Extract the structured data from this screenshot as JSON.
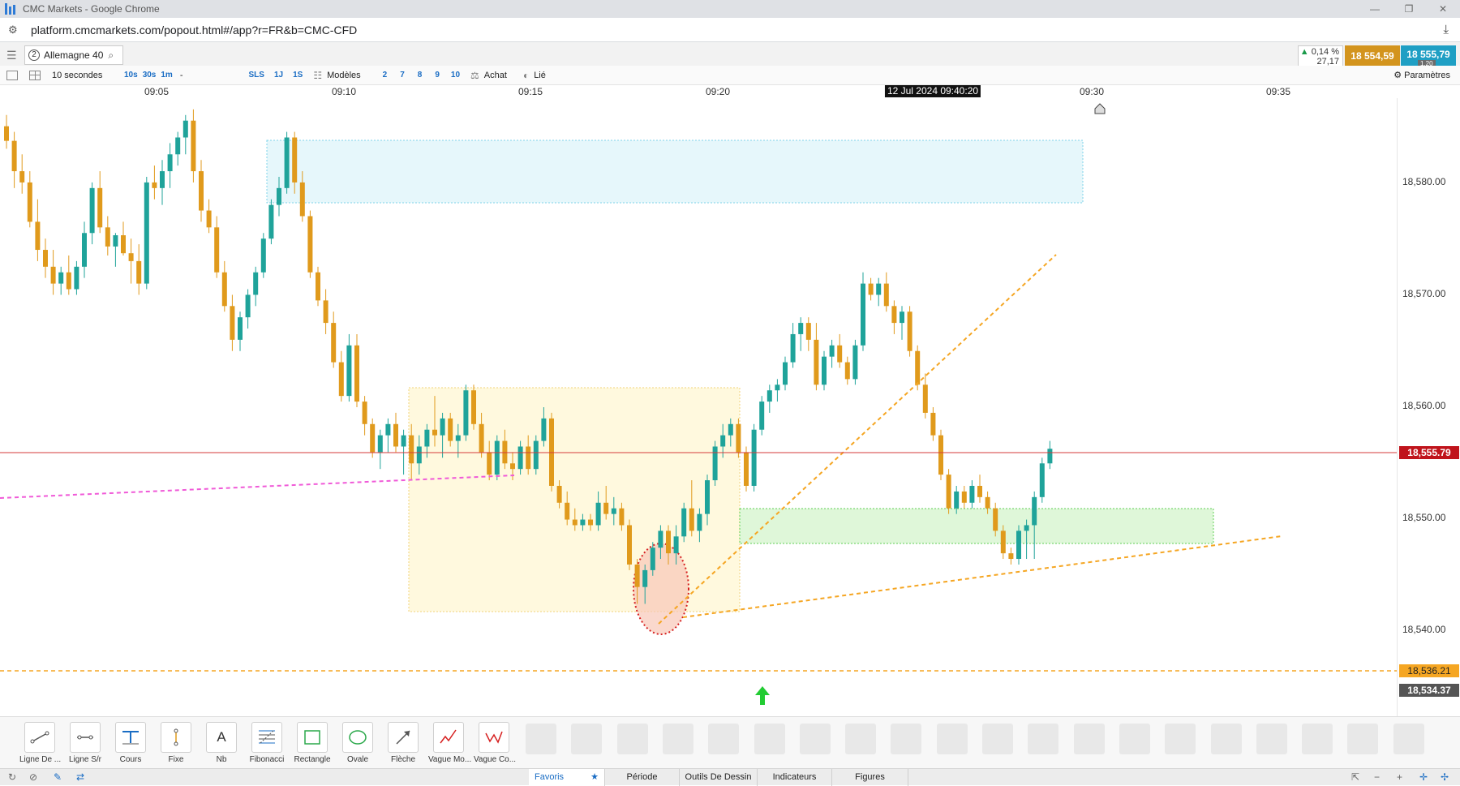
{
  "browser": {
    "window_title": "CMC Markets - Google Chrome",
    "url": "platform.cmcmarkets.com/popout.html#/app?r=FR&b=CMC-CFD"
  },
  "instrument": {
    "panel_number": "2",
    "name": "Allemagne 40",
    "change_pct": "0,14 %",
    "change_pts": "27,17",
    "sell_price": "18 554,59",
    "buy_price": "18 555,79",
    "spread": "1.20"
  },
  "chart_toolbar": {
    "interval": "10 secondes",
    "quick_intervals": [
      "10s",
      "30s",
      "1m",
      "-"
    ],
    "sls": "SLS",
    "day": "1J",
    "week": "1S",
    "templates": "Modèles",
    "layout_counts": [
      "2",
      "7",
      "8",
      "9",
      "10"
    ],
    "buy": "Achat",
    "linked": "Lié",
    "settings": "Paramètres"
  },
  "time_axis": {
    "ticks": [
      "09:05",
      "09:10",
      "09:15",
      "09:20",
      "09:30",
      "09:35"
    ],
    "cursor_label": "12 Jul 2024 09:40:20"
  },
  "price_axis": {
    "ticks": [
      "18,580.00",
      "18,570.00",
      "18,560.00",
      "18,550.00",
      "18,540.00"
    ],
    "current_price": "18,555.79",
    "line_price": "18,536.21",
    "low_price": "18,534.37",
    "colors": {
      "current": "#c0141c",
      "line": "#f5a623",
      "low": "#555555"
    }
  },
  "chart_data": {
    "type": "candlestick",
    "xlabel": "",
    "ylabel": "",
    "ylim": [
      18532,
      18587
    ],
    "colors": {
      "up": "#1fa39a",
      "down": "#e09a1c"
    },
    "candles": [
      [
        18584.5,
        18585.5,
        18582.5,
        18583.2
      ],
      [
        18583.2,
        18584.0,
        18579.0,
        18580.5
      ],
      [
        18580.5,
        18582.0,
        18578.5,
        18579.5
      ],
      [
        18579.5,
        18580.5,
        18575.5,
        18576.0
      ],
      [
        18576.0,
        18578.0,
        18572.5,
        18573.5
      ],
      [
        18573.5,
        18574.5,
        18571.0,
        18572.0
      ],
      [
        18572.0,
        18573.5,
        18569.5,
        18570.5
      ],
      [
        18570.5,
        18572.0,
        18569.5,
        18571.5
      ],
      [
        18571.5,
        18573.0,
        18569.5,
        18570.0
      ],
      [
        18570.0,
        18572.5,
        18569.5,
        18572.0
      ],
      [
        18572.0,
        18576.0,
        18571.0,
        18575.0
      ],
      [
        18575.0,
        18579.5,
        18574.0,
        18579.0
      ],
      [
        18579.0,
        18580.5,
        18575.0,
        18575.5
      ],
      [
        18575.5,
        18576.5,
        18573.0,
        18573.8
      ],
      [
        18573.8,
        18575.0,
        18572.0,
        18574.8
      ],
      [
        18574.8,
        18576.0,
        18573.0,
        18573.2
      ],
      [
        18573.2,
        18574.5,
        18570.5,
        18572.5
      ],
      [
        18572.5,
        18574.0,
        18569.5,
        18570.5
      ],
      [
        18570.5,
        18580.0,
        18570.0,
        18579.5
      ],
      [
        18579.5,
        18581.0,
        18578.0,
        18579.0
      ],
      [
        18579.0,
        18581.5,
        18577.5,
        18580.5
      ],
      [
        18580.5,
        18583.0,
        18579.0,
        18582.0
      ],
      [
        18582.0,
        18584.0,
        18581.0,
        18583.5
      ],
      [
        18583.5,
        18585.5,
        18582.0,
        18585.0
      ],
      [
        18585.0,
        18586.0,
        18579.5,
        18580.5
      ],
      [
        18580.5,
        18581.5,
        18576.0,
        18577.0
      ],
      [
        18577.0,
        18578.0,
        18575.0,
        18575.5
      ],
      [
        18575.5,
        18576.5,
        18571.0,
        18571.5
      ],
      [
        18571.5,
        18572.5,
        18568.0,
        18568.5
      ],
      [
        18568.5,
        18569.5,
        18564.5,
        18565.5
      ],
      [
        18565.5,
        18568.0,
        18564.5,
        18567.5
      ],
      [
        18567.5,
        18570.0,
        18566.5,
        18569.5
      ],
      [
        18569.5,
        18572.0,
        18568.5,
        18571.5
      ],
      [
        18571.5,
        18575.0,
        18571.0,
        18574.5
      ],
      [
        18574.5,
        18578.0,
        18574.0,
        18577.5
      ],
      [
        18577.5,
        18580.0,
        18576.5,
        18579.0
      ],
      [
        18579.0,
        18584.0,
        18578.5,
        18583.5
      ],
      [
        18583.5,
        18584.0,
        18578.5,
        18579.5
      ],
      [
        18579.5,
        18580.5,
        18576.0,
        18576.5
      ],
      [
        18576.5,
        18577.0,
        18571.0,
        18571.5
      ],
      [
        18571.5,
        18572.0,
        18568.5,
        18569.0
      ],
      [
        18569.0,
        18570.0,
        18566.0,
        18567.0
      ],
      [
        18567.0,
        18568.0,
        18563.0,
        18563.5
      ],
      [
        18563.5,
        18564.5,
        18560.0,
        18560.5
      ],
      [
        18560.5,
        18566.0,
        18560.0,
        18565.0
      ],
      [
        18565.0,
        18566.0,
        18559.5,
        18560.0
      ],
      [
        18560.0,
        18560.5,
        18557.0,
        18558.0
      ],
      [
        18558.0,
        18558.5,
        18555.0,
        18555.5
      ],
      [
        18555.5,
        18557.5,
        18554.0,
        18557.0
      ],
      [
        18557.0,
        18558.5,
        18555.5,
        18558.0
      ],
      [
        18558.0,
        18559.0,
        18555.5,
        18556.0
      ],
      [
        18556.0,
        18557.5,
        18553.5,
        18557.0
      ],
      [
        18557.0,
        18558.0,
        18553.0,
        18554.5
      ],
      [
        18554.5,
        18557.0,
        18553.5,
        18556.0
      ],
      [
        18556.0,
        18558.0,
        18555.0,
        18557.5
      ],
      [
        18557.5,
        18560.5,
        18556.0,
        18557.0
      ],
      [
        18557.0,
        18559.0,
        18555.0,
        18558.5
      ],
      [
        18558.5,
        18559.0,
        18556.0,
        18556.5
      ],
      [
        18556.5,
        18558.0,
        18555.0,
        18557.0
      ],
      [
        18557.0,
        18561.5,
        18556.5,
        18561.0
      ],
      [
        18561.0,
        18561.5,
        18557.5,
        18558.0
      ],
      [
        18558.0,
        18559.0,
        18555.0,
        18555.5
      ],
      [
        18555.5,
        18556.5,
        18553.0,
        18553.5
      ],
      [
        18553.5,
        18557.0,
        18553.0,
        18556.5
      ],
      [
        18556.5,
        18557.5,
        18554.0,
        18554.5
      ],
      [
        18554.5,
        18555.5,
        18553.0,
        18554.0
      ],
      [
        18554.0,
        18556.5,
        18553.5,
        18556.0
      ],
      [
        18556.0,
        18557.0,
        18553.5,
        18554.0
      ],
      [
        18554.0,
        18557.0,
        18553.5,
        18556.5
      ],
      [
        18556.5,
        18559.5,
        18556.0,
        18558.5
      ],
      [
        18558.5,
        18559.0,
        18552.0,
        18552.5
      ],
      [
        18552.5,
        18553.0,
        18550.5,
        18551.0
      ],
      [
        18551.0,
        18552.0,
        18549.0,
        18549.5
      ],
      [
        18549.5,
        18550.5,
        18548.5,
        18549.0
      ],
      [
        18549.0,
        18550.0,
        18548.5,
        18549.5
      ],
      [
        18549.5,
        18550.0,
        18548.5,
        18549.0
      ],
      [
        18549.0,
        18552.0,
        18548.5,
        18551.0
      ],
      [
        18551.0,
        18552.5,
        18549.5,
        18550.0
      ],
      [
        18550.0,
        18551.5,
        18549.0,
        18550.5
      ],
      [
        18550.5,
        18551.0,
        18548.5,
        18549.0
      ],
      [
        18549.0,
        18549.5,
        18545.0,
        18545.5
      ],
      [
        18545.5,
        18546.0,
        18542.0,
        18543.5
      ],
      [
        18543.5,
        18545.5,
        18542.0,
        18545.0
      ],
      [
        18545.0,
        18547.5,
        18544.5,
        18547.0
      ],
      [
        18547.0,
        18549.0,
        18546.0,
        18548.5
      ],
      [
        18548.5,
        18549.0,
        18545.5,
        18546.5
      ],
      [
        18546.5,
        18549.0,
        18545.5,
        18548.0
      ],
      [
        18548.0,
        18551.0,
        18547.5,
        18550.5
      ],
      [
        18550.5,
        18553.0,
        18548.0,
        18548.5
      ],
      [
        18548.5,
        18550.5,
        18547.5,
        18550.0
      ],
      [
        18550.0,
        18553.5,
        18549.0,
        18553.0
      ],
      [
        18553.0,
        18556.5,
        18552.5,
        18556.0
      ],
      [
        18556.0,
        18558.0,
        18555.0,
        18557.0
      ],
      [
        18557.0,
        18558.5,
        18556.0,
        18558.0
      ],
      [
        18558.0,
        18558.5,
        18555.0,
        18555.5
      ],
      [
        18555.5,
        18556.0,
        18552.0,
        18552.5
      ],
      [
        18552.5,
        18558.0,
        18552.0,
        18557.5
      ],
      [
        18557.5,
        18560.5,
        18557.0,
        18560.0
      ],
      [
        18560.0,
        18561.5,
        18559.0,
        18561.0
      ],
      [
        18561.0,
        18562.0,
        18560.0,
        18561.5
      ],
      [
        18561.5,
        18564.0,
        18561.0,
        18563.5
      ],
      [
        18563.5,
        18567.0,
        18563.0,
        18566.0
      ],
      [
        18566.0,
        18567.5,
        18564.5,
        18567.0
      ],
      [
        18567.0,
        18567.5,
        18564.5,
        18565.5
      ],
      [
        18565.5,
        18567.0,
        18561.0,
        18561.5
      ],
      [
        18561.5,
        18564.5,
        18561.0,
        18564.0
      ],
      [
        18564.0,
        18565.5,
        18563.0,
        18565.0
      ],
      [
        18565.0,
        18566.0,
        18563.0,
        18563.5
      ],
      [
        18563.5,
        18564.0,
        18561.5,
        18562.0
      ],
      [
        18562.0,
        18565.5,
        18561.5,
        18565.0
      ],
      [
        18565.0,
        18571.5,
        18564.5,
        18570.5
      ],
      [
        18570.5,
        18571.0,
        18569.0,
        18569.5
      ],
      [
        18569.5,
        18571.0,
        18568.5,
        18570.5
      ],
      [
        18570.5,
        18571.5,
        18568.0,
        18568.5
      ],
      [
        18568.5,
        18569.0,
        18566.0,
        18567.0
      ],
      [
        18567.0,
        18568.5,
        18565.5,
        18568.0
      ],
      [
        18568.0,
        18568.5,
        18564.0,
        18564.5
      ],
      [
        18564.5,
        18565.0,
        18561.0,
        18561.5
      ],
      [
        18561.5,
        18562.5,
        18558.5,
        18559.0
      ],
      [
        18559.0,
        18559.5,
        18556.5,
        18557.0
      ],
      [
        18557.0,
        18557.5,
        18553.0,
        18553.5
      ],
      [
        18553.5,
        18554.0,
        18550.0,
        18550.5
      ],
      [
        18550.5,
        18552.5,
        18550.0,
        18552.0
      ],
      [
        18552.0,
        18552.5,
        18550.5,
        18551.0
      ],
      [
        18551.0,
        18553.0,
        18550.5,
        18552.5
      ],
      [
        18552.5,
        18553.5,
        18551.0,
        18551.5
      ],
      [
        18551.5,
        18552.0,
        18550.0,
        18550.5
      ],
      [
        18550.5,
        18551.0,
        18548.0,
        18548.5
      ],
      [
        18548.5,
        18549.0,
        18546.0,
        18546.5
      ],
      [
        18546.5,
        18547.0,
        18545.5,
        18546.0
      ],
      [
        18546.0,
        18549.0,
        18545.5,
        18548.5
      ],
      [
        18548.5,
        18549.5,
        18546.0,
        18549.0
      ],
      [
        18549.0,
        18552.0,
        18546.0,
        18551.5
      ],
      [
        18551.5,
        18555.0,
        18551.0,
        18554.5
      ],
      [
        18554.5,
        18556.5,
        18554.0,
        18555.8
      ]
    ]
  },
  "drawing_tools": [
    {
      "label": "Ligne De ...",
      "icon": "trendline-icon"
    },
    {
      "label": "Ligne S/r",
      "icon": "sr-line-icon"
    },
    {
      "label": "Cours",
      "icon": "price-line-icon"
    },
    {
      "label": "Fixe",
      "icon": "vertical-line-icon"
    },
    {
      "label": "Nb",
      "icon": "text-note-icon",
      "glyph": "A"
    },
    {
      "label": "Fibonacci",
      "icon": "fibonacci-icon"
    },
    {
      "label": "Rectangle",
      "icon": "rectangle-icon"
    },
    {
      "label": "Ovale",
      "icon": "oval-icon"
    },
    {
      "label": "Flèche",
      "icon": "arrow-icon"
    },
    {
      "label": "Vague Mo...",
      "icon": "motive-wave-icon"
    },
    {
      "label": "Vague Co...",
      "icon": "corrective-wave-icon"
    }
  ],
  "bottom_tabs": [
    {
      "label": "Favoris",
      "active": true
    },
    {
      "label": "Période",
      "active": false
    },
    {
      "label": "Outils De Dessin",
      "active": false
    },
    {
      "label": "Indicateurs",
      "active": false
    },
    {
      "label": "Figures",
      "active": false
    }
  ]
}
